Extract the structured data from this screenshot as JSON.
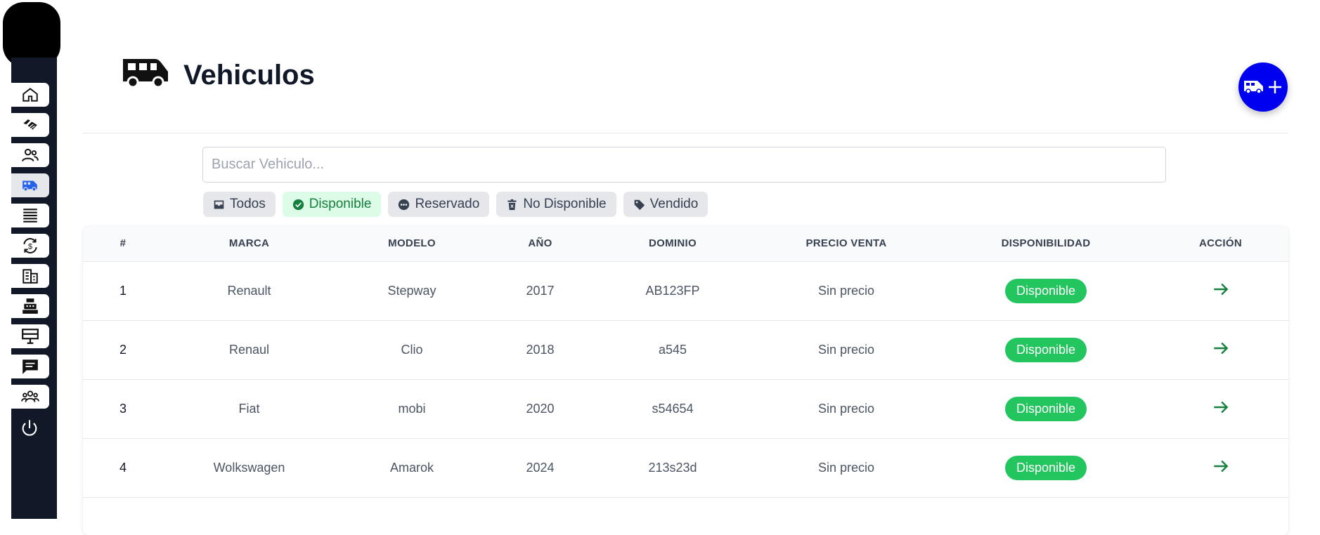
{
  "page": {
    "title": "Vehiculos"
  },
  "sidebar": {
    "items": [
      {
        "icon": "home-icon"
      },
      {
        "icon": "handshake-icon"
      },
      {
        "icon": "users-icon"
      },
      {
        "icon": "van-icon",
        "active": true
      },
      {
        "icon": "list-icon"
      },
      {
        "icon": "exchange-dollar-icon"
      },
      {
        "icon": "building-icon"
      },
      {
        "icon": "cash-register-icon"
      },
      {
        "icon": "monitor-icon"
      },
      {
        "icon": "chat-icon"
      },
      {
        "icon": "group-icon"
      }
    ],
    "power_icon": "power-icon"
  },
  "fab": {
    "icons": [
      "van-icon",
      "plus-icon"
    ]
  },
  "search": {
    "placeholder": "Buscar Vehiculo..."
  },
  "filters": [
    {
      "label": "Todos",
      "icon": "inbox-icon"
    },
    {
      "label": "Disponible",
      "icon": "check-circle-icon",
      "active": true
    },
    {
      "label": "Reservado",
      "icon": "dots-circle-icon"
    },
    {
      "label": "No Disponible",
      "icon": "trash-icon"
    },
    {
      "label": "Vendido",
      "icon": "tag-icon"
    }
  ],
  "table": {
    "headers": [
      "#",
      "MARCA",
      "MODELO",
      "AÑO",
      "DOMINIO",
      "PRECIO VENTA",
      "DISPONIBILIDAD",
      "ACCIÓN"
    ],
    "rows": [
      {
        "num": "1",
        "marca": "Renault",
        "modelo": "Stepway",
        "anio": "2017",
        "dominio": "AB123FP",
        "precio": "Sin precio",
        "estado": "Disponible"
      },
      {
        "num": "2",
        "marca": "Renaul",
        "modelo": "Clio",
        "anio": "2018",
        "dominio": "a545",
        "precio": "Sin precio",
        "estado": "Disponible"
      },
      {
        "num": "3",
        "marca": "Fiat",
        "modelo": "mobi",
        "anio": "2020",
        "dominio": "s54654",
        "precio": "Sin precio",
        "estado": "Disponible"
      },
      {
        "num": "4",
        "marca": "Wolkswagen",
        "modelo": "Amarok",
        "anio": "2024",
        "dominio": "213s23d",
        "precio": "Sin precio",
        "estado": "Disponible"
      }
    ]
  },
  "colors": {
    "accent": "#0000f0",
    "sidebar": "#111827",
    "success": "#22c55e",
    "success_light": "#dcfce7",
    "action_arrow": "#15803d"
  }
}
